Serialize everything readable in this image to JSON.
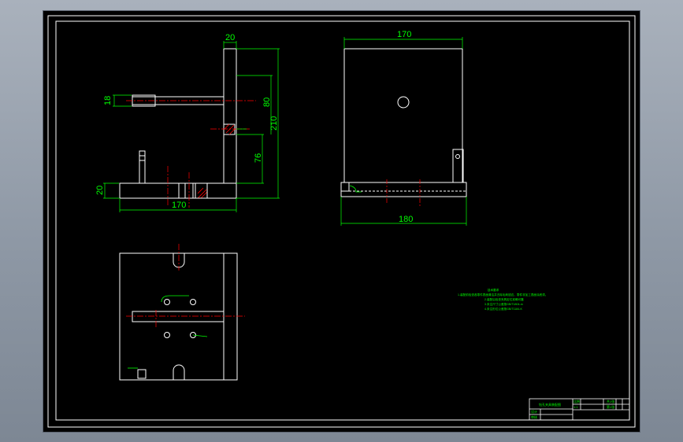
{
  "colors": {
    "background": "#000000",
    "outline": "#ffffff",
    "dimension": "#00ff00",
    "centerline": "#ff0000",
    "section_hatch": "#ff0000",
    "window": "#9aa3ae"
  },
  "drawing": {
    "side_view_dims": {
      "top_width": "20",
      "pin_dia": "18",
      "upper_height": "80",
      "overall_height": "210",
      "lower_height": "76",
      "base_thickness": "20",
      "base_width": "170"
    },
    "front_view_dims": {
      "top_width": "170",
      "bottom_width": "180"
    },
    "notes": {
      "title": "技术要求",
      "lines": [
        "1.装配前检查各零件表面清洁并去除毛刺锐边，零件非加工表面涂底漆。",
        "2.装配后检查夹具定位准确可靠",
        "3.未注尺寸公差按GB/T1804-m",
        "4.未注形位公差按GB/T1184-K"
      ]
    },
    "title_block": {
      "drawing_name": "钻孔夹具装配图",
      "ratio_label": "比例",
      "ratio_value": "1:1",
      "designer_label": "设计",
      "checker_label": "审核",
      "sheet_label": "共1张",
      "sheet_value": "第1张"
    }
  }
}
